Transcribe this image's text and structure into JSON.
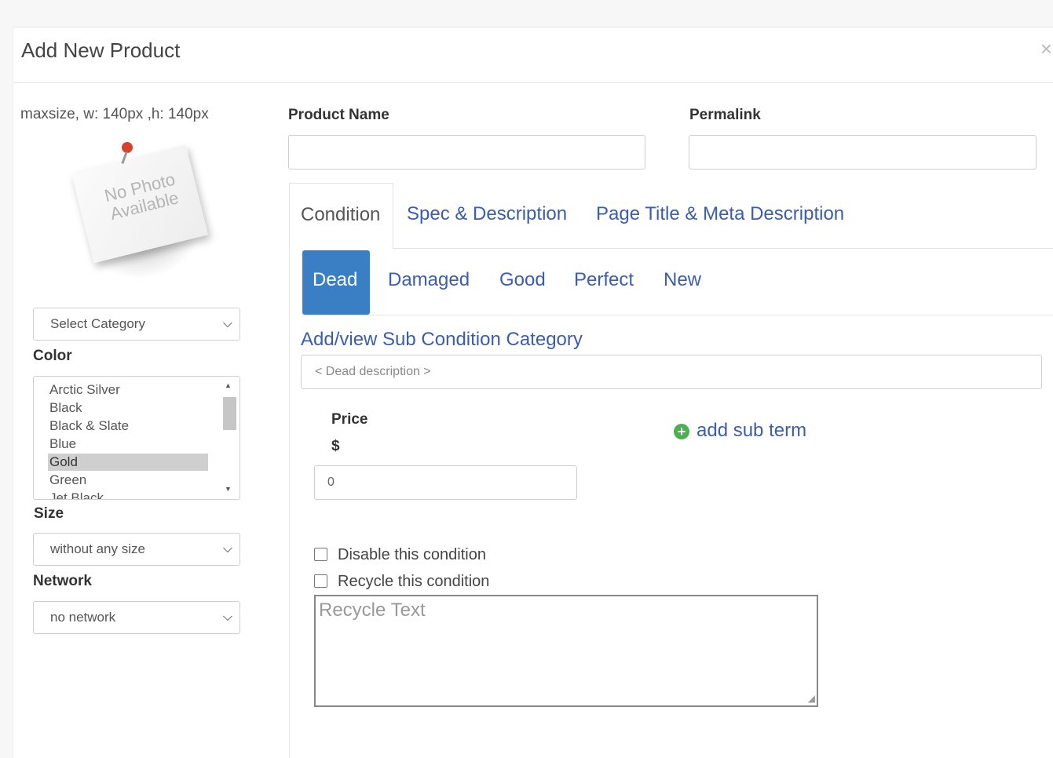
{
  "modal": {
    "title": "Add New Product",
    "close": "×"
  },
  "photo": {
    "maxsize": "maxsize, w: 140px ,h: 140px",
    "placeholder_line1": "No Photo",
    "placeholder_line2": "Available"
  },
  "category": {
    "selected": "Select Category"
  },
  "color": {
    "label": "Color",
    "options": [
      "Arctic Silver",
      "Black",
      "Black & Slate",
      "Blue",
      "Gold",
      "Green",
      "Jet Black"
    ],
    "selected": "Gold"
  },
  "size": {
    "label": "Size",
    "selected": "without any size"
  },
  "network": {
    "label": "Network",
    "selected": "no network"
  },
  "product_name": {
    "label": "Product Name",
    "value": ""
  },
  "permalink": {
    "label": "Permalink",
    "value": ""
  },
  "tabs": [
    {
      "label": "Condition",
      "active": true
    },
    {
      "label": "Spec & Description",
      "active": false
    },
    {
      "label": "Page Title & Meta Description",
      "active": false
    }
  ],
  "condition_tabs": [
    {
      "label": "Dead",
      "active": true
    },
    {
      "label": "Damaged",
      "active": false
    },
    {
      "label": "Good",
      "active": false
    },
    {
      "label": "Perfect",
      "active": false
    },
    {
      "label": "New",
      "active": false
    }
  ],
  "condition": {
    "sub_condition_link": "Add/view Sub Condition Category",
    "description_placeholder": "< Dead description >",
    "price_label": "Price",
    "currency": "$",
    "price_value": "0",
    "add_sub_term": "add sub term",
    "disable_label": "Disable this condition",
    "recycle_label": "Recycle this condition",
    "recycle_placeholder": "Recycle Text"
  },
  "colors": {
    "link": "#3a5dae",
    "active_tab_bg": "#3a7fc4",
    "add_icon": "#4caf50"
  }
}
